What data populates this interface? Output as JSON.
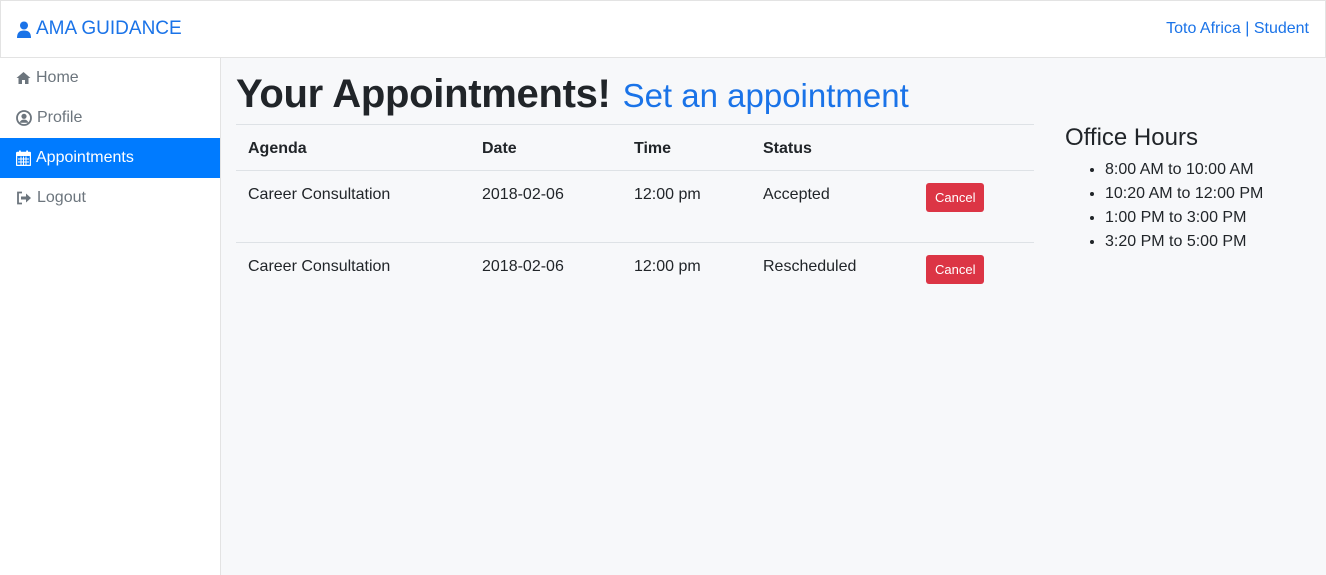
{
  "navbar": {
    "brand": "AMA GUIDANCE",
    "user": "Toto Africa | Student"
  },
  "sidebar": {
    "items": [
      {
        "label": "Home",
        "icon": "home-icon"
      },
      {
        "label": "Profile",
        "icon": "user-circle-icon"
      },
      {
        "label": "Appointments",
        "icon": "calendar-icon",
        "active": true
      },
      {
        "label": "Logout",
        "icon": "sign-out-icon"
      }
    ]
  },
  "main": {
    "title": "Your Appointments!",
    "set_link": "Set an appointment",
    "columns": [
      "Agenda",
      "Date",
      "Time",
      "Status"
    ],
    "rows": [
      {
        "agenda": "Career Consultation",
        "date": "2018-02-06",
        "time": "12:00 pm",
        "status": "Accepted",
        "action": "Cancel"
      },
      {
        "agenda": "Career Consultation",
        "date": "2018-02-06",
        "time": "12:00 pm",
        "status": "Rescheduled",
        "action": "Cancel"
      }
    ]
  },
  "office_hours": {
    "title": "Office Hours",
    "slots": [
      "8:00 AM to 10:00 AM",
      "10:20 AM to 12:00 PM",
      "1:00 PM to 3:00 PM",
      "3:20 PM to 5:00 PM"
    ]
  },
  "colors": {
    "accent": "#1a73e8",
    "active_nav": "#007bff",
    "danger": "#dc3545"
  }
}
